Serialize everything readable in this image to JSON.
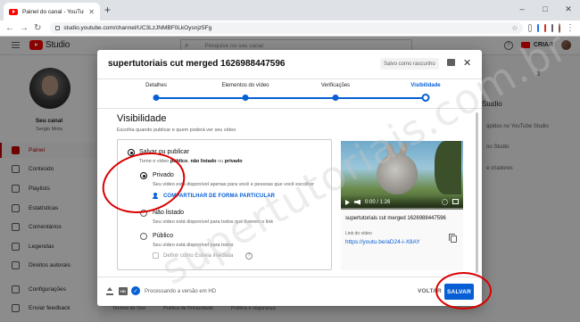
{
  "browser": {
    "tab_title": "Painel do canal - YouTube Studio",
    "url": "studio.youtube.com/channel/UC3LzJNMBF0LkOysnjz5Fg",
    "window_controls": [
      "–",
      "□",
      "✕"
    ]
  },
  "header": {
    "logo_text": "Studio",
    "search_placeholder": "Pesquise no seu canal",
    "create_label": "CRIAR",
    "help_glyph": "?"
  },
  "sidebar": {
    "channel_name": "Seu canal",
    "channel_owner": "Sergio Mota",
    "items": [
      {
        "label": "Painel",
        "active": true
      },
      {
        "label": "Conteúdo"
      },
      {
        "label": "Playlists"
      },
      {
        "label": "Estatísticas"
      },
      {
        "label": "Comentários"
      },
      {
        "label": "Legendas"
      },
      {
        "label": "Direitos autorais"
      },
      {
        "label": "Configurações"
      },
      {
        "label": "Enviar feedback"
      }
    ]
  },
  "background": {
    "studio_label": "Studio",
    "line1": "ápidos no YouTube Studio",
    "line2": "no Studio",
    "line3": "e criadores",
    "footer_links": [
      "Termos de Uso",
      "Política de Privacidade",
      "Política e segurança"
    ]
  },
  "dialog": {
    "title": "supertutoriais cut merged 1626988447596",
    "draft_status": "Salvo como rascunho",
    "close_glyph": "✕",
    "steps": [
      {
        "label": "Detalhes"
      },
      {
        "label": "Elementos do vídeo"
      },
      {
        "label": "Verificações"
      },
      {
        "label": "Visibilidade",
        "current": true
      }
    ],
    "section_title": "Visibilidade",
    "section_subtitle": "Escolha quando publicar e quem poderá ver seu vídeo",
    "options": {
      "save_publish": {
        "label": "Salvar ou publicar",
        "desc_pre": "Torne o vídeo ",
        "desc_b1": "público",
        "desc_mid": ", ",
        "desc_b2": "não listado",
        "desc_and": " ou ",
        "desc_b3": "privado"
      },
      "private": {
        "label": "Privado",
        "desc": "Seu vídeo está disponível apenas para você e pessoas que você escolher",
        "share_label": "COMPARTILHAR DE FORMA PARTICULAR",
        "selected": true
      },
      "unlisted": {
        "label": "Não listado",
        "desc": "Seu vídeo está disponível para todos que tiverem o link"
      },
      "public": {
        "label": "Público",
        "desc": "Seu vídeo está disponível para todos",
        "premiere_label": "Definir como Estreia imediata"
      }
    },
    "video": {
      "time": "0:00 / 1:26",
      "title": "supertutoriais cut merged 1626988447596",
      "link_label": "Link do vídeo",
      "link": "https://youtu.be/aD24-i-X8AY"
    },
    "footer": {
      "status": "Processando a versão em HD",
      "hd_badge": "HD",
      "check_glyph": "✓",
      "back_label": "VOLTAR",
      "save_label": "SALVAR"
    }
  },
  "watermark_text": "supertutoriais.com.br",
  "colors": {
    "accent": "#065fd4",
    "brand_red": "#ff0000",
    "annotation": "#d90000"
  }
}
